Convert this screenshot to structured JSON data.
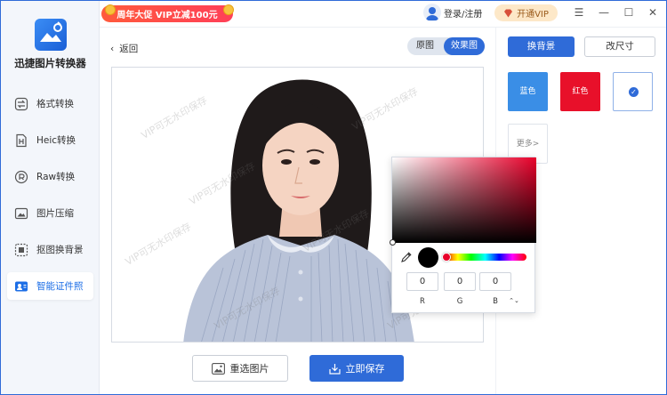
{
  "app": {
    "title": "迅捷图片转换器",
    "promo_text": "周年大促 VIP立减100元",
    "login_text": "登录/注册",
    "vip_text": "开通VIP",
    "window_buttons": [
      "☰",
      "—",
      "☐",
      "✕"
    ]
  },
  "sidebar": {
    "items": [
      {
        "label": "格式转换",
        "icon": "format-convert-icon"
      },
      {
        "label": "Heic转换",
        "icon": "heic-icon"
      },
      {
        "label": "Raw转换",
        "icon": "raw-icon"
      },
      {
        "label": "图片压缩",
        "icon": "compress-icon"
      },
      {
        "label": "抠图换背景",
        "icon": "cutout-icon"
      },
      {
        "label": "智能证件照",
        "icon": "id-photo-icon",
        "active": true
      }
    ]
  },
  "main": {
    "back_label": "返回",
    "toggle": {
      "original": "原图",
      "effect": "效果图",
      "selected": "效果图"
    },
    "watermark_text": "VIP可无水印保存",
    "reselect_label": "重选图片",
    "save_label": "立即保存"
  },
  "right_panel": {
    "tabs": {
      "background": "换背景",
      "resize": "改尺寸",
      "selected": "换背景"
    },
    "swatches": [
      {
        "label": "蓝色",
        "color": "#3a8ee6"
      },
      {
        "label": "红色",
        "color": "#e8102a"
      }
    ],
    "custom_selected": true,
    "more_label": "更多>"
  },
  "color_picker": {
    "r": "0",
    "g": "0",
    "b": "0",
    "r_label": "R",
    "g_label": "G",
    "b_label": "B",
    "mode_toggle": "⌃⌄",
    "preview_color": "#000000",
    "hue_color": "#e8002a"
  }
}
